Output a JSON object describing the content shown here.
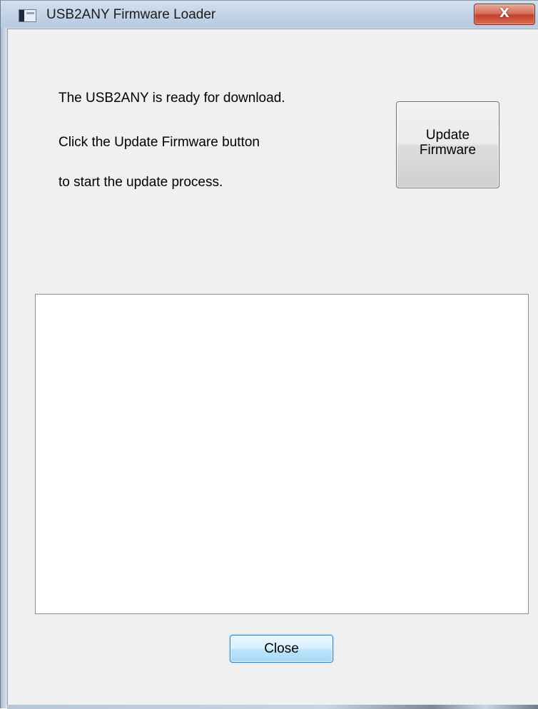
{
  "window": {
    "title": "USB2ANY Firmware Loader",
    "close_glyph": "X",
    "app_icon": "app-window-icon",
    "close_icon": "close-x-icon"
  },
  "message": {
    "line1": "The USB2ANY is ready for download.",
    "line2": "Click the Update Firmware button",
    "line3": "to start the update process."
  },
  "buttons": {
    "update_firmware": "Update\nFirmware",
    "close": "Close"
  },
  "log": {
    "text": ""
  },
  "colors": {
    "dialog_background": "#f0f0f0",
    "close_button_red": "#c5402a",
    "default_button_blue": "#3c7fb1"
  }
}
